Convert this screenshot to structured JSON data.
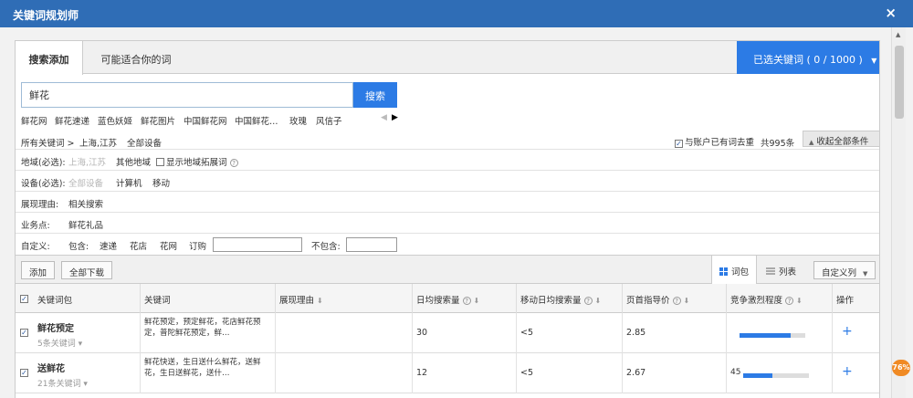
{
  "window": {
    "title": "关键词规划师",
    "close": "×"
  },
  "tabs": [
    {
      "label": "搜索添加"
    },
    {
      "label": "可能适合你的词"
    }
  ],
  "selected_keywords": {
    "label": "已选关键词 ( 0 / 1000 )",
    "caret": "▼"
  },
  "search": {
    "value": "鲜花",
    "button": "搜索"
  },
  "suggestions": [
    "鲜花网",
    "鲜花速递",
    "蓝色妖姬",
    "鲜花图片",
    "中国鲜花网",
    "中国鲜花…",
    "玫瑰",
    "风信子"
  ],
  "suggest_arrows": {
    "prev": "◀",
    "next": "▶"
  },
  "breadcrumb": {
    "root": "所有关键词 >",
    "region": "上海,江苏",
    "device": "全部设备"
  },
  "dedupe": {
    "checked": "✓",
    "label": "与账户已有词去重"
  },
  "total": "共995条",
  "collapse": {
    "caret": "▲",
    "label": "收起全部条件"
  },
  "filters": {
    "region": {
      "label": "地域(必选):",
      "selected": "上海,江苏",
      "other": "其他地域",
      "expand": "显示地域拓展词",
      "help": "?"
    },
    "device": {
      "label": "设备(必选):",
      "all": "全部设备",
      "pc": "计算机",
      "mobile": "移动"
    },
    "reason": {
      "label": "展现理由:",
      "value": "相关搜索"
    },
    "business": {
      "label": "业务点:",
      "value": "鲜花礼品"
    },
    "custom": {
      "label": "自定义:",
      "include": "包含:",
      "opts": [
        "速递",
        "花店",
        "花网",
        "订购"
      ],
      "exclude": "不包含:"
    }
  },
  "toolbar": {
    "add": "添加",
    "download": "全部下载",
    "pack_view": "词包",
    "list_view": "列表",
    "custom_cols": "自定义列",
    "caret": "▼"
  },
  "columns": [
    "关键词包",
    "关键词",
    "展现理由",
    "日均搜索量",
    "移动日均搜索量",
    "页首指导价",
    "竞争激烈程度",
    "操作"
  ],
  "header_checked": "✓",
  "sort_icon": "⬇",
  "help_icon": "?",
  "rows": [
    {
      "checked": "✓",
      "package": "鲜花预定",
      "count": "5条关键词 ▾",
      "keywords": "鲜花预定，预定鲜花，花店鲜花预定，普陀鲜花预定，鲜…",
      "reason": "",
      "daily": "30",
      "mobile": "<5",
      "price": "2.85",
      "competition_pct": 0.78,
      "action": "+"
    },
    {
      "checked": "✓",
      "package": "送鲜花",
      "count": "21条关键词 ▾",
      "keywords": "鲜花快送，生日送什么鲜花，送鲜花，生日送鲜花，送什…",
      "reason": "",
      "daily": "12",
      "mobile": "<5",
      "price": "2.67",
      "competition_val": "45",
      "competition_pct": 0.45,
      "action": "+"
    }
  ],
  "badge": "76%",
  "scroll_up": "▲"
}
